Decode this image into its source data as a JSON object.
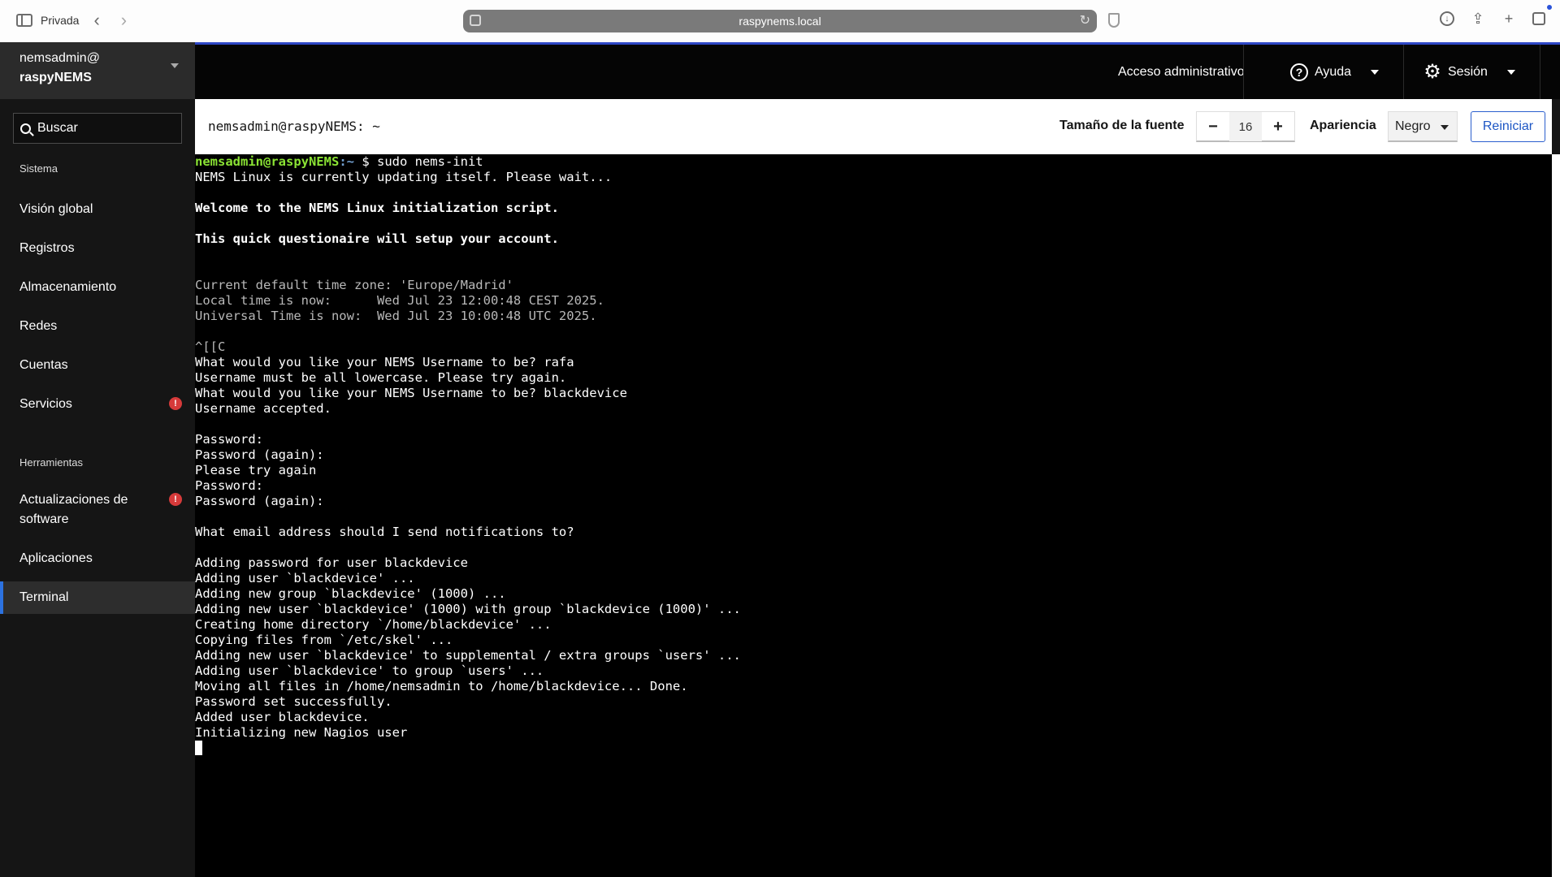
{
  "browser": {
    "private_label": "Privada",
    "url": "raspynems.local"
  },
  "sidebar": {
    "host_line1": "nemsadmin@",
    "host_line2": "raspyNEMS",
    "search_label": "Buscar",
    "section_system": "Sistema",
    "section_tools": "Herramientas",
    "items": [
      {
        "label": "Visión global"
      },
      {
        "label": "Registros"
      },
      {
        "label": "Almacenamiento"
      },
      {
        "label": "Redes"
      },
      {
        "label": "Cuentas"
      },
      {
        "label": "Servicios",
        "badge": "!"
      },
      {
        "label": "Actualizaciones de software",
        "badge": "!"
      },
      {
        "label": "Aplicaciones"
      },
      {
        "label": "Terminal",
        "active": true
      }
    ]
  },
  "topbar": {
    "admin_access": "Acceso administrativo",
    "help": "Ayuda",
    "session": "Sesión"
  },
  "terminal_toolbar": {
    "title": "nemsadmin@raspyNEMS: ~",
    "font_size_label": "Tamaño de la fuente",
    "minus": "−",
    "font_size_value": "16",
    "plus": "+",
    "appearance_label": "Apariencia",
    "appearance_value": "Negro",
    "reset_label": "Reiniciar"
  },
  "terminal": {
    "prompt_user": "nemsadmin@raspyNEMS",
    "prompt_path": ":~",
    "prompt_symbol": " $ ",
    "command": "sudo nems-init",
    "lines": [
      {
        "text": "NEMS Linux is currently updating itself. Please wait...",
        "style": ""
      },
      {
        "text": "",
        "style": ""
      },
      {
        "text": "Welcome to the NEMS Linux initialization script.",
        "style": "bold"
      },
      {
        "text": "",
        "style": ""
      },
      {
        "text": "This quick questionaire will setup your account.",
        "style": "bold"
      },
      {
        "text": "",
        "style": ""
      },
      {
        "text": "",
        "style": ""
      },
      {
        "text": "Current default time zone: 'Europe/Madrid'",
        "style": "gray"
      },
      {
        "text": "Local time is now:      Wed Jul 23 12:00:48 CEST 2025.",
        "style": "gray"
      },
      {
        "text": "Universal Time is now:  Wed Jul 23 10:00:48 UTC 2025.",
        "style": "gray"
      },
      {
        "text": "",
        "style": ""
      },
      {
        "text": "^[[C",
        "style": "gray"
      },
      {
        "text": "What would you like your NEMS Username to be? rafa",
        "style": ""
      },
      {
        "text": "Username must be all lowercase. Please try again.",
        "style": ""
      },
      {
        "text": "What would you like your NEMS Username to be? blackdevice",
        "style": ""
      },
      {
        "text": "Username accepted.",
        "style": ""
      },
      {
        "text": "",
        "style": ""
      },
      {
        "text": "Password:",
        "style": ""
      },
      {
        "text": "Password (again):",
        "style": ""
      },
      {
        "text": "Please try again",
        "style": ""
      },
      {
        "text": "Password:",
        "style": ""
      },
      {
        "text": "Password (again):",
        "style": ""
      },
      {
        "text": "",
        "style": ""
      },
      {
        "text": "What email address should I send notifications to?",
        "style": ""
      },
      {
        "text": "",
        "style": ""
      },
      {
        "text": "Adding password for user blackdevice",
        "style": ""
      },
      {
        "text": "Adding user `blackdevice' ...",
        "style": ""
      },
      {
        "text": "Adding new group `blackdevice' (1000) ...",
        "style": ""
      },
      {
        "text": "Adding new user `blackdevice' (1000) with group `blackdevice (1000)' ...",
        "style": ""
      },
      {
        "text": "Creating home directory `/home/blackdevice' ...",
        "style": ""
      },
      {
        "text": "Copying files from `/etc/skel' ...",
        "style": ""
      },
      {
        "text": "Adding new user `blackdevice' to supplemental / extra groups `users' ...",
        "style": ""
      },
      {
        "text": "Adding user `blackdevice' to group `users' ...",
        "style": ""
      },
      {
        "text": "Moving all files in /home/nemsadmin to /home/blackdevice... Done.",
        "style": ""
      },
      {
        "text": "Password set successfully.",
        "style": ""
      },
      {
        "text": "Added user blackdevice.",
        "style": ""
      },
      {
        "text": "Initializing new Nagios user",
        "style": ""
      }
    ]
  }
}
